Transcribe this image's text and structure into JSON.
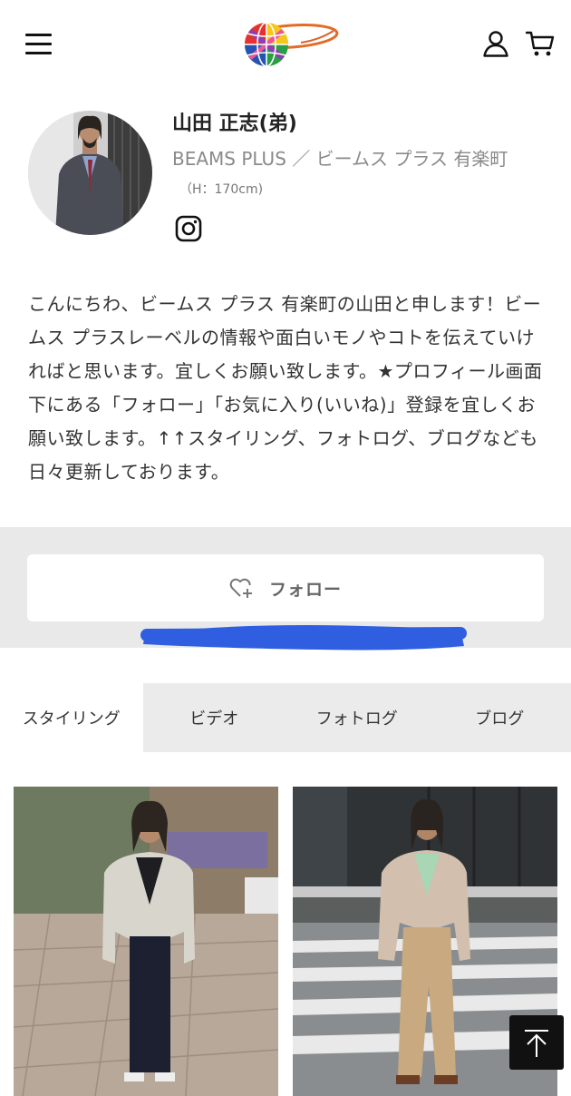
{
  "header": {
    "menu_icon": "hamburger-menu-icon",
    "logo_icon": "beams-globe-logo",
    "user_icon": "user-account-icon",
    "cart_icon": "shopping-cart-icon"
  },
  "profile": {
    "name": "山田 正志(弟)",
    "shop": "BEAMS PLUS ／ ビームス プラス 有楽町",
    "height": "（H：170cm)",
    "social_icon": "instagram-icon",
    "bio": "こんにちわ、ビームス プラス 有楽町の山田と申します！ビームス プラスレーベルの情報や面白いモノやコトを伝えていければと思います。宜しくお願い致します。★プロフィール画面下にある「フォロー」「お気に入り(いいね)」登録を宜しくお願い致します。↑↑スタイリング、フォトログ、ブログなども日々更新しております。"
  },
  "follow": {
    "label": "フォロー",
    "icon": "heart-plus-icon"
  },
  "tabs": [
    {
      "label": "スタイリング",
      "active": true
    },
    {
      "label": "ビデオ",
      "active": false
    },
    {
      "label": "フォトログ",
      "active": false
    },
    {
      "label": "ブログ",
      "active": false
    }
  ],
  "styling_photos": [
    {
      "description": "man in light grey blazer on street"
    },
    {
      "description": "man in beige shirt jacket at crosswalk"
    }
  ],
  "colors": {
    "scribble": "#2f5fe0",
    "follow_band": "#e9e9e9",
    "tab_inactive": "#ebebeb"
  },
  "scroll_top_icon": "arrow-up-to-top-icon"
}
